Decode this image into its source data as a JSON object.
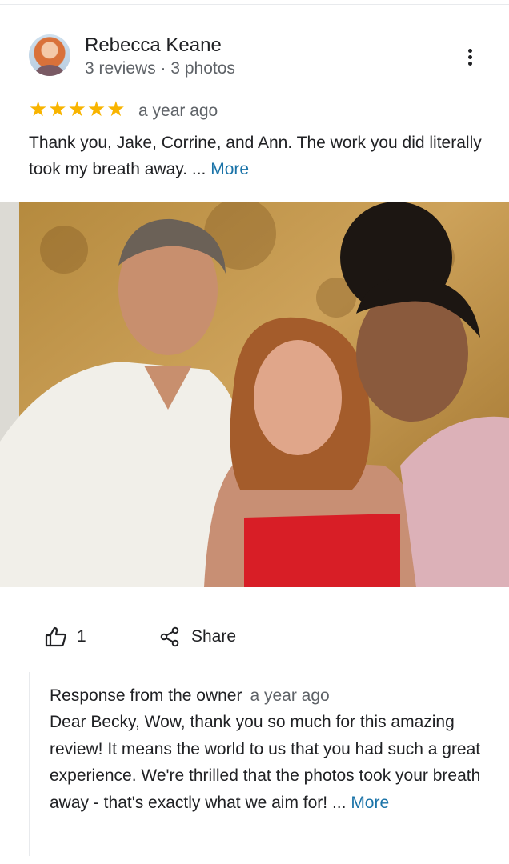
{
  "review": {
    "author_name": "Rebecca Keane",
    "author_meta": "3 reviews · 3 photos",
    "stars": "★★★★★",
    "rating": 5,
    "time": "a year ago",
    "text": "Thank you, Jake, Corrine, and Ann. The work you did literally took my breath away. ... ",
    "more_label": "More"
  },
  "actions": {
    "like_count": "1",
    "share_label": "Share"
  },
  "owner_response": {
    "title": "Response from the owner",
    "time": "a year ago",
    "text": "Dear Becky, Wow, thank you so much for this amazing review! It means the world to us that you had such a great experience. We're thrilled that the photos took your breath away - that's exactly what we aim for! ... ",
    "more_label": "More"
  },
  "colors": {
    "star": "#f8b400",
    "link": "#1a73a8",
    "secondary_text": "#5f6368"
  },
  "icons": [
    "avatar",
    "more-vert-icon",
    "star-icon",
    "thumb-up-icon",
    "share-icon"
  ]
}
